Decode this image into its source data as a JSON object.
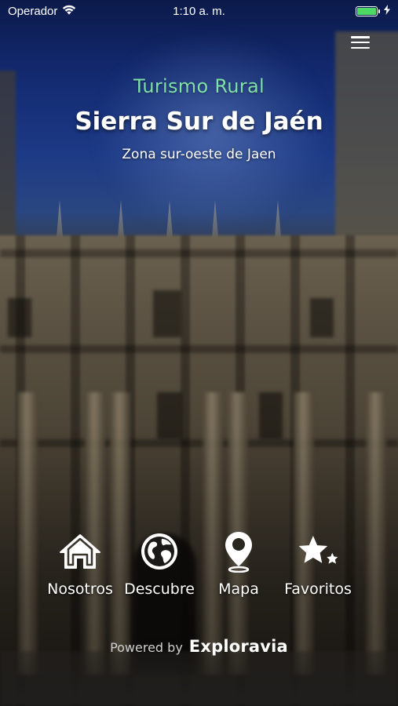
{
  "status_bar": {
    "carrier": "Operador",
    "time": "1:10 a. m."
  },
  "header": {
    "subtitle": "Turismo Rural",
    "title": "Sierra Sur de Jaén",
    "tagline": "Zona sur-oeste de Jaen"
  },
  "nav": {
    "items": [
      {
        "label": "Nosotros",
        "icon": "home-icon"
      },
      {
        "label": "Descubre",
        "icon": "globe-icon"
      },
      {
        "label": "Mapa",
        "icon": "map-pin-icon"
      },
      {
        "label": "Favoritos",
        "icon": "stars-icon"
      }
    ]
  },
  "footer": {
    "powered_label": "Powered by",
    "brand": "Exploravia"
  },
  "colors": {
    "accent_green": "#7fe0a8",
    "battery_green": "#4cd964"
  }
}
